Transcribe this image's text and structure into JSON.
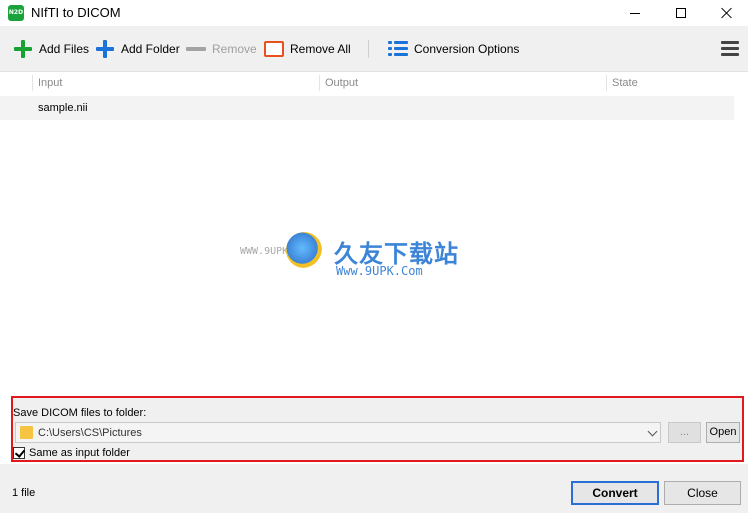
{
  "window": {
    "icon_text": "N2D",
    "title": "NIfTI to DICOM"
  },
  "toolbar": {
    "add_files": "Add Files",
    "add_folder": "Add Folder",
    "remove": "Remove",
    "remove_all": "Remove All",
    "conversion_options": "Conversion Options"
  },
  "list": {
    "columns": [
      "Input",
      "Output",
      "State"
    ],
    "rows": [
      {
        "input": "sample.nii",
        "output": "",
        "state": ""
      }
    ]
  },
  "watermark": {
    "brand_cn": "久友下载站",
    "url": "Www.9UPK.Com",
    "left_text": "WWW.9UPK.COM"
  },
  "output": {
    "label": "Save DICOM files to folder:",
    "path": "C:\\Users\\CS\\Pictures",
    "browse_label": "...",
    "open_label": "Open",
    "same_folder_label": "Same as input folder",
    "same_folder_checked": true
  },
  "status": {
    "file_count": "1 file"
  },
  "actions": {
    "convert": "Convert",
    "close": "Close"
  },
  "colors": {
    "accent_blue": "#1a73d9",
    "add_green": "#17a333",
    "remove_all_orange": "#e8501e",
    "highlight_red": "#e0191e"
  }
}
